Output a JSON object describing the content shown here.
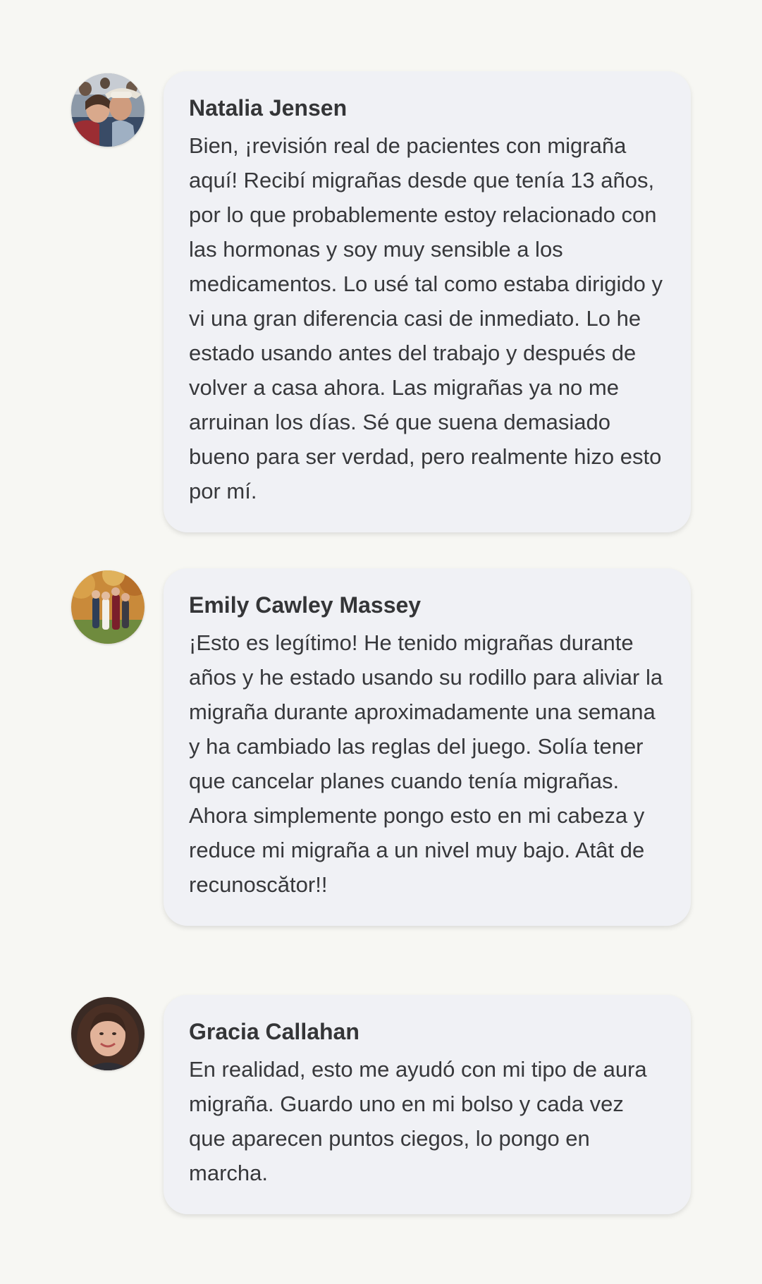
{
  "comments": [
    {
      "name": "Natalia Jensen",
      "text": "Bien, ¡revisión real de pacientes con migraña aquí! Recibí migrañas desde que tenía 13 años, por lo que probablemente estoy relacionado con las hormonas y soy muy sensible a los medicamentos. Lo usé tal como estaba dirigido y vi una gran diferencia casi de inmediato. Lo he estado usando antes del trabajo y después de volver a casa ahora. Las migrañas ya no me arruinan los días. Sé que suena demasiado bueno para ser verdad, pero realmente hizo esto por mí."
    },
    {
      "name": "Emily Cawley Massey",
      "text": "¡Esto es legítimo! He tenido migrañas durante años y he estado usando su rodillo para aliviar la migraña durante aproximadamente una semana y ha cambiado las reglas del juego. Solía tener que cancelar planes cuando tenía migrañas. Ahora simplemente pongo esto en mi cabeza y reduce mi migraña a un nivel muy bajo. Atât de recunoscător!!"
    },
    {
      "name": "Gracia Callahan",
      "text": "En realidad, esto me ayudó con mi tipo de aura migraña. Guardo uno en mi bolso y cada vez que aparecen puntos ciegos, lo pongo en marcha."
    }
  ]
}
